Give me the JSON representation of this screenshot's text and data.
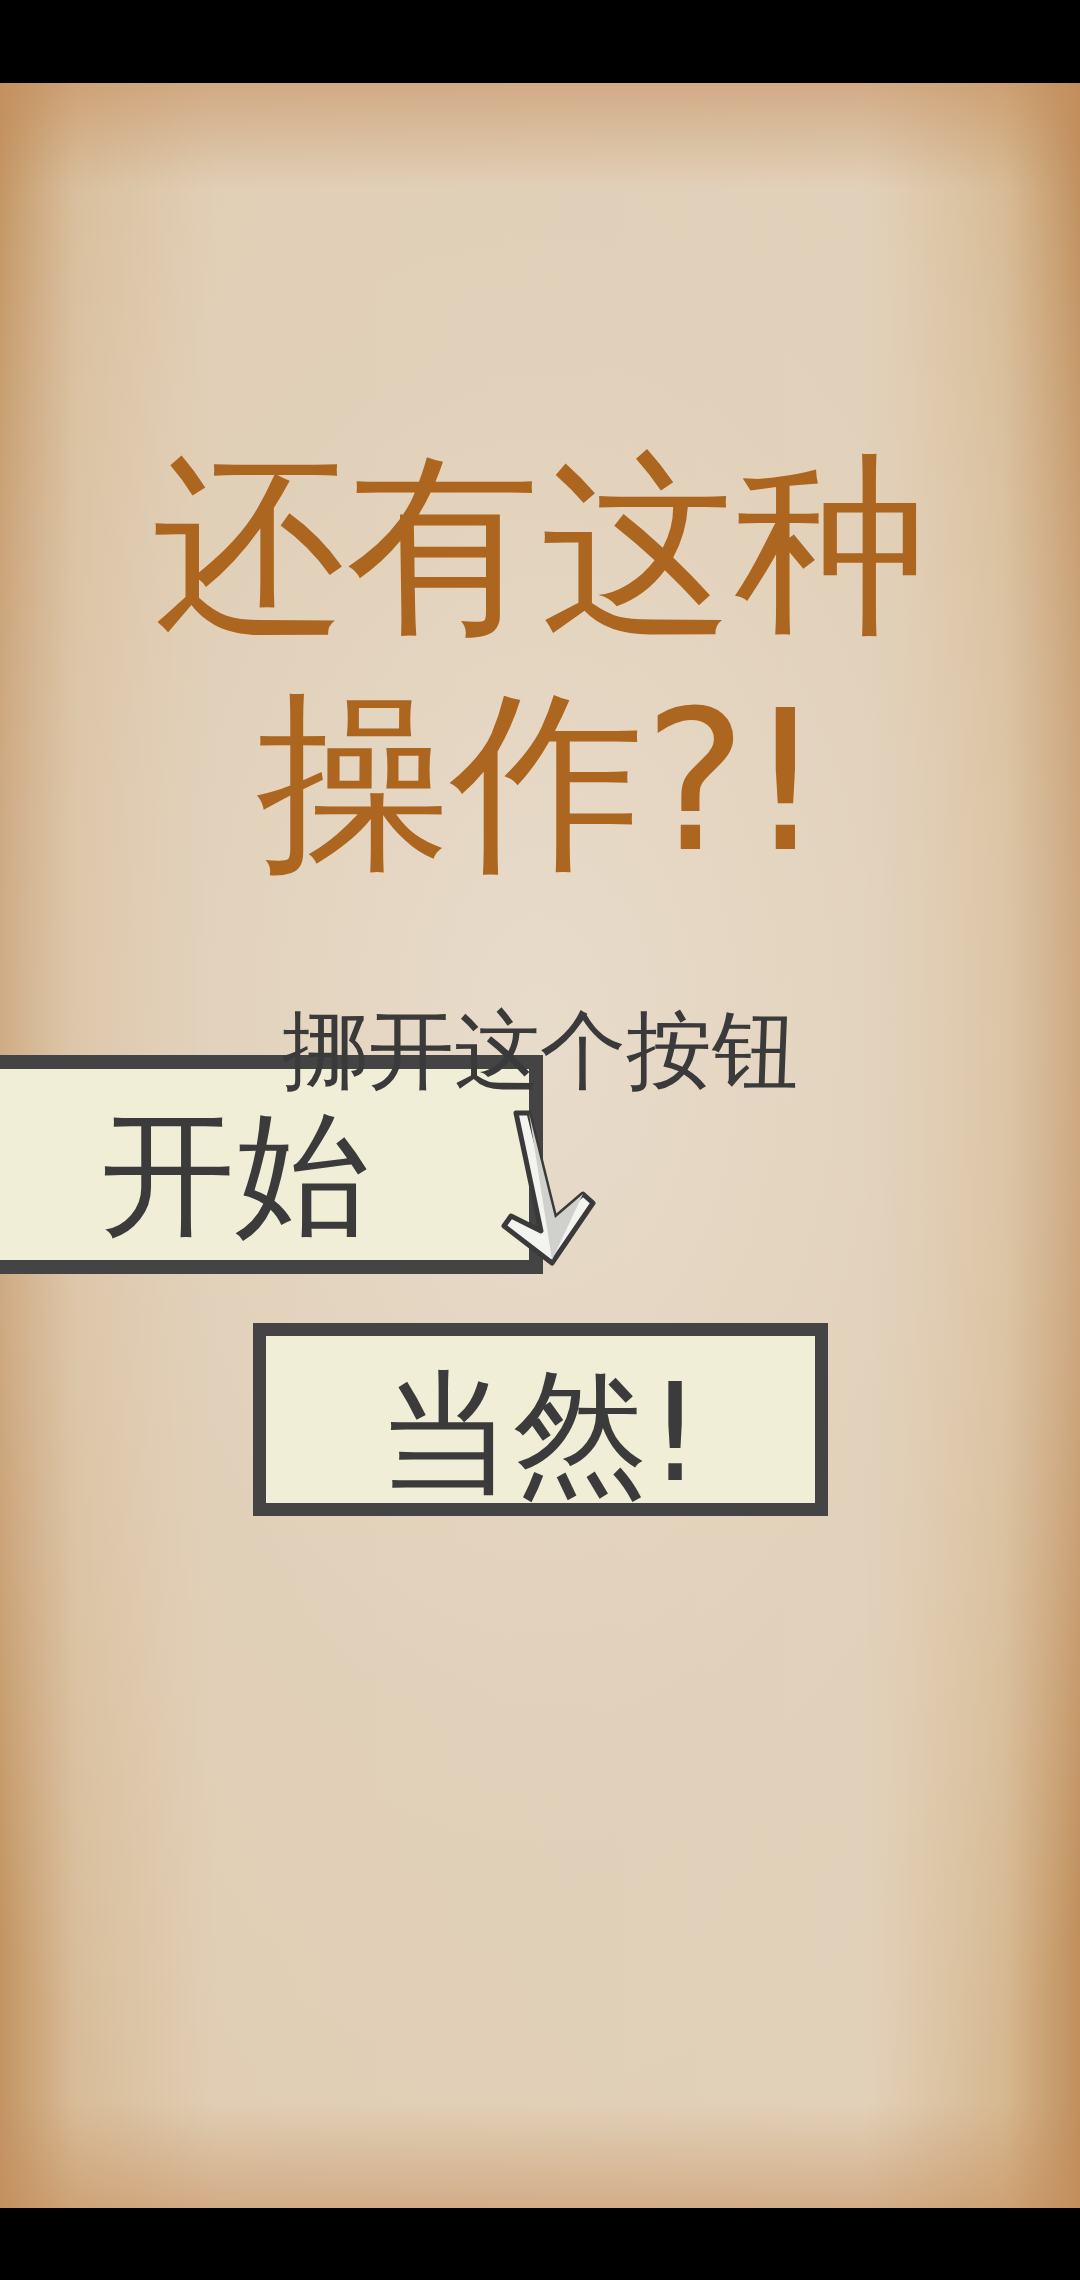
{
  "title": "还有这种操作?!",
  "hint": "挪开这个按钮",
  "start_button": {
    "label": "开始"
  },
  "answer_button": {
    "label": "当然!"
  }
}
